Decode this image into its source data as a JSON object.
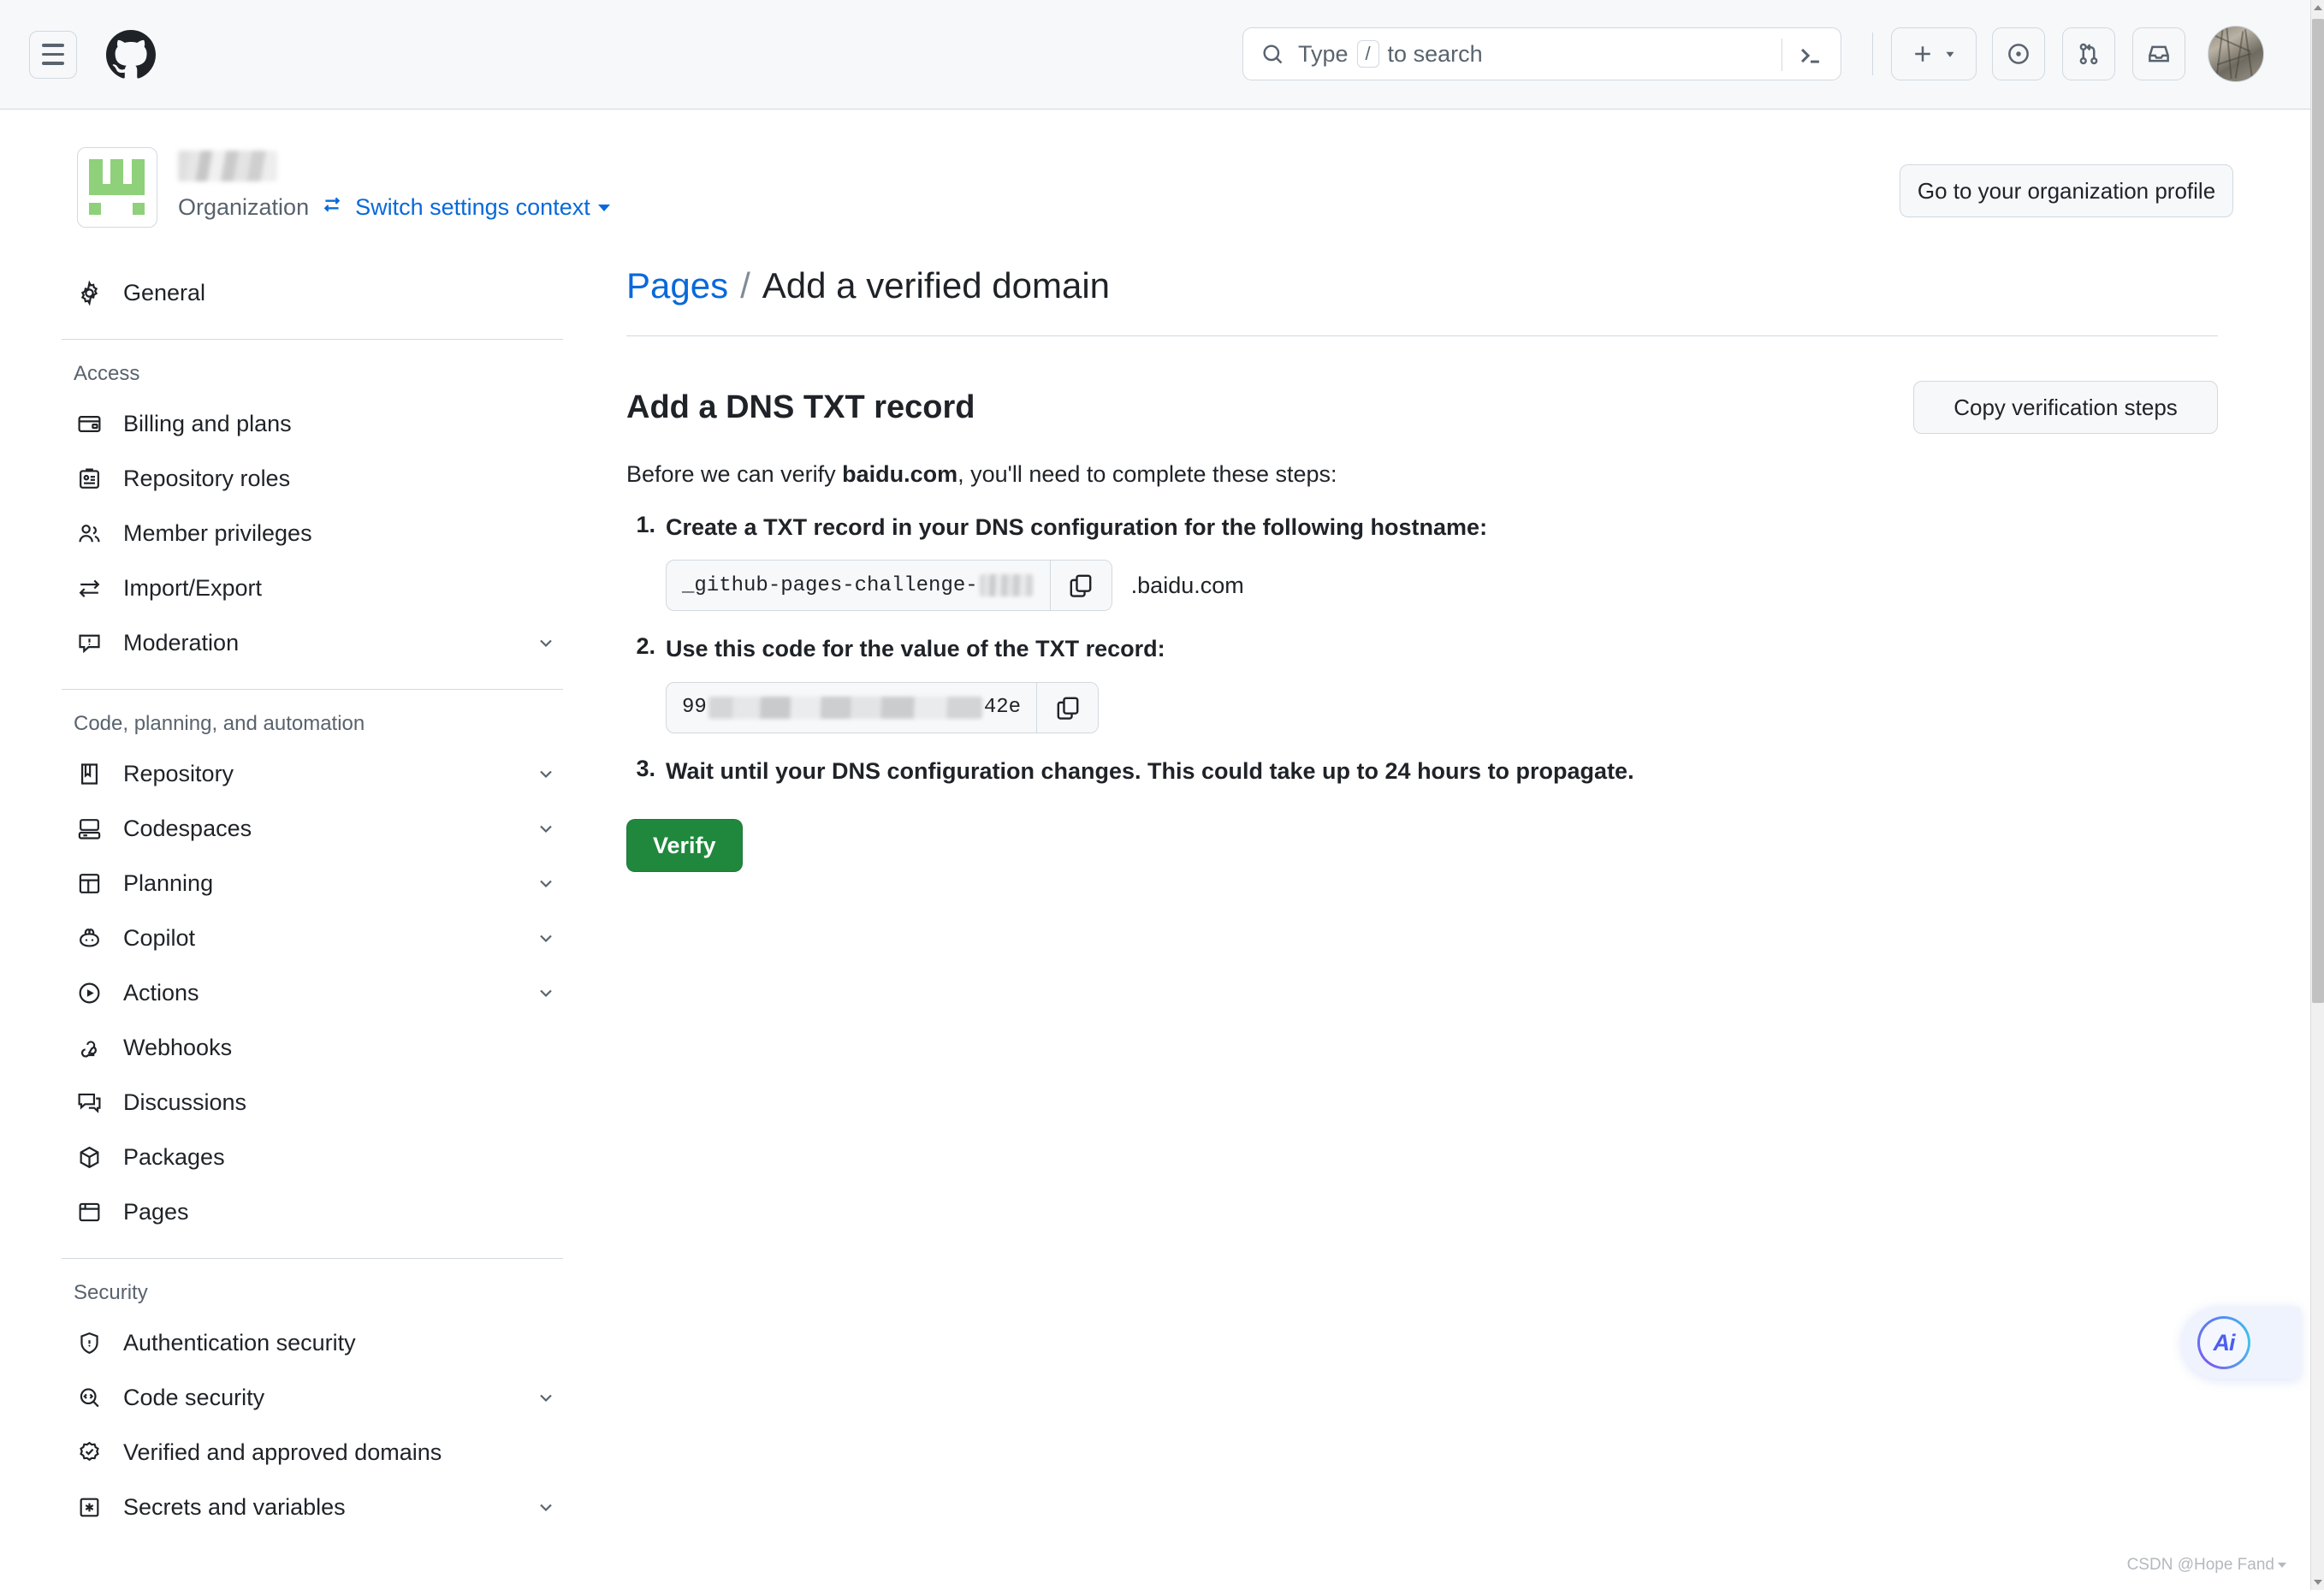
{
  "header": {
    "menu_icon": "hamburger-menu-icon",
    "logo_icon": "github-logo-icon",
    "search": {
      "icon": "search-icon",
      "placeholder_prefix": "Type",
      "key_hint": "/",
      "placeholder_suffix": "to search",
      "terminal_icon": "terminal-icon"
    },
    "actions": [
      {
        "name": "create-new-button",
        "icon": "plus-icon",
        "has_caret": true
      },
      {
        "name": "issues-button",
        "icon": "issue-opened-icon"
      },
      {
        "name": "pull-requests-button",
        "icon": "git-pull-request-icon"
      },
      {
        "name": "inbox-button",
        "icon": "inbox-icon"
      }
    ],
    "avatar": "user-avatar"
  },
  "org": {
    "avatar_icon": "organization-avatar",
    "name_redacted": "",
    "type_label": "Organization",
    "switch_icon": "arrow-switch-icon",
    "switch_label": "Switch settings context",
    "profile_button": "Go to your organization profile"
  },
  "sidebar": {
    "top_items": [
      {
        "label": "General",
        "icon": "gear-icon",
        "expandable": false
      }
    ],
    "sections": [
      {
        "title": "Access",
        "items": [
          {
            "label": "Billing and plans",
            "icon": "credit-card-icon",
            "expandable": false
          },
          {
            "label": "Repository roles",
            "icon": "id-badge-icon",
            "expandable": false
          },
          {
            "label": "Member privileges",
            "icon": "people-icon",
            "expandable": false
          },
          {
            "label": "Import/Export",
            "icon": "arrow-switch-icon",
            "expandable": false
          },
          {
            "label": "Moderation",
            "icon": "report-icon",
            "expandable": true
          }
        ]
      },
      {
        "title": "Code, planning, and automation",
        "items": [
          {
            "label": "Repository",
            "icon": "repo-icon",
            "expandable": true
          },
          {
            "label": "Codespaces",
            "icon": "codespaces-icon",
            "expandable": true
          },
          {
            "label": "Planning",
            "icon": "project-icon",
            "expandable": true
          },
          {
            "label": "Copilot",
            "icon": "copilot-icon",
            "expandable": true
          },
          {
            "label": "Actions",
            "icon": "play-icon",
            "expandable": true
          },
          {
            "label": "Webhooks",
            "icon": "webhook-icon",
            "expandable": false
          },
          {
            "label": "Discussions",
            "icon": "comment-discussion-icon",
            "expandable": false
          },
          {
            "label": "Packages",
            "icon": "package-icon",
            "expandable": false
          },
          {
            "label": "Pages",
            "icon": "browser-icon",
            "expandable": false
          }
        ]
      },
      {
        "title": "Security",
        "items": [
          {
            "label": "Authentication security",
            "icon": "shield-lock-icon",
            "expandable": false
          },
          {
            "label": "Code security",
            "icon": "code-review-icon",
            "expandable": true
          },
          {
            "label": "Verified and approved domains",
            "icon": "verified-icon",
            "expandable": false
          },
          {
            "label": "Secrets and variables",
            "icon": "asterisk-key-icon",
            "expandable": true
          }
        ]
      }
    ]
  },
  "main": {
    "breadcrumb": {
      "parent": "Pages",
      "separator": "/",
      "current": "Add a verified domain"
    },
    "section_title": "Add a DNS TXT record",
    "copy_steps_button": "Copy verification steps",
    "intro_prefix": "Before we can verify ",
    "intro_domain": "baidu.com",
    "intro_suffix": ", you'll need to complete these steps:",
    "steps": [
      {
        "number": "1.",
        "text": "Create a TXT record in your DNS configuration for the following hostname:",
        "field": {
          "value_prefix": "_github-pages-challenge-",
          "value_redacted": true,
          "copy_icon": "copy-icon",
          "suffix": ".baidu.com"
        }
      },
      {
        "number": "2.",
        "text": "Use this code for the value of the TXT record:",
        "field": {
          "value_prefix": "99",
          "value_redacted": true,
          "value_tail": "42e",
          "copy_icon": "copy-icon",
          "suffix": ""
        }
      },
      {
        "number": "3.",
        "text": "Wait until your DNS configuration changes. This could take up to 24 hours to propagate.",
        "field": null
      }
    ],
    "verify_button": "Verify"
  },
  "floating": {
    "ai_label": "Ai"
  },
  "watermark": "CSDN @Hope Fand",
  "colors": {
    "accent_blue": "#0969da",
    "success_green": "#1f883d",
    "border": "#d1d9e0",
    "header_bg": "#f6f8fa",
    "text": "#1f2328",
    "muted": "#59636e"
  }
}
